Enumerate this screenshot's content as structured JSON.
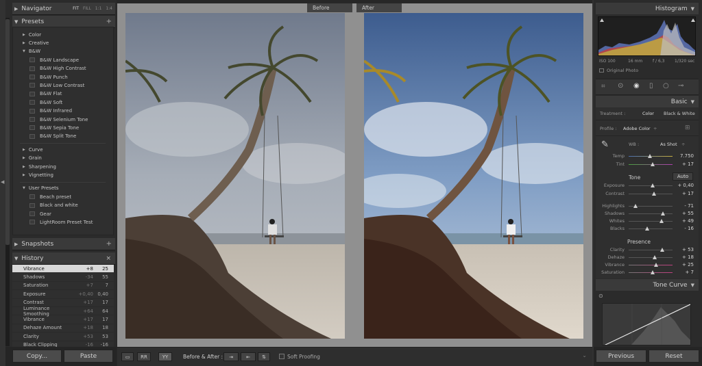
{
  "left_panel": {
    "navigator": {
      "title": "Navigator",
      "zoom_options": [
        "FIT",
        "FILL",
        "1:1",
        "1:4"
      ]
    },
    "presets": {
      "title": "Presets",
      "add_symbol": "+",
      "groups_top": [
        "Color",
        "Creative",
        "B&W"
      ],
      "bw_items": [
        "B&W Landscape",
        "B&W High Contrast",
        "B&W Punch",
        "B&W Low Contrast",
        "B&W Flat",
        "B&W Soft",
        "B&W Infrared",
        "B&W Selenium Tone",
        "B&W Sepia Tone",
        "B&W Split Tone"
      ],
      "groups_mid": [
        "Curve",
        "Grain",
        "Sharpening",
        "Vignetting"
      ],
      "user_group": "User Presets",
      "user_items": [
        "Beach preset",
        "Black and white",
        "Gear",
        "LightRoom Preset Test"
      ]
    },
    "snapshots": {
      "title": "Snapshots",
      "add_symbol": "+"
    },
    "history": {
      "title": "History",
      "close_symbol": "×",
      "rows": [
        {
          "name": "Vibrance",
          "delta": "+8",
          "value": "25",
          "selected": true
        },
        {
          "name": "Shadows",
          "delta": "-34",
          "value": "55"
        },
        {
          "name": "Saturation",
          "delta": "+7",
          "value": "7"
        },
        {
          "name": "Exposure",
          "delta": "+0,40",
          "value": "0,40"
        },
        {
          "name": "Contrast",
          "delta": "+17",
          "value": "17"
        },
        {
          "name": "Luminance Smoothing",
          "delta": "+64",
          "value": "64"
        },
        {
          "name": "Vibrance",
          "delta": "+17",
          "value": "17"
        },
        {
          "name": "Dehaze Amount",
          "delta": "+18",
          "value": "18"
        },
        {
          "name": "Clarity",
          "delta": "+53",
          "value": "53"
        },
        {
          "name": "Black Clipping",
          "delta": "-16",
          "value": "-16"
        }
      ]
    },
    "buttons": {
      "copy": "Copy...",
      "paste": "Paste"
    }
  },
  "center": {
    "before_label": "Before",
    "after_label": "After",
    "toolbar": {
      "view_buttons": [
        "▭",
        "RR",
        "YY"
      ],
      "before_after_label": "Before & After :",
      "soft_proofing": "Soft Proofing"
    }
  },
  "right_panel": {
    "histogram": {
      "title": "Histogram",
      "iso": "ISO 100",
      "focal": "16 mm",
      "aperture": "f / 6,3",
      "shutter": "1/320 sec",
      "original_photo": "Original Photo"
    },
    "basic": {
      "title": "Basic",
      "treatment_label": "Treatment :",
      "treatment_color": "Color",
      "treatment_bw": "Black & White",
      "profile_label": "Profile :",
      "profile_value": "Adobe Color",
      "profile_arrow": "÷",
      "wb_label": "WB :",
      "wb_value": "As Shot",
      "wb_arrow": "÷",
      "tone_label": "Tone",
      "auto_label": "Auto",
      "presence_label": "Presence",
      "sliders": [
        {
          "label": "Temp",
          "value": "7.750",
          "pos": 0.48,
          "group": "wb"
        },
        {
          "label": "Tint",
          "value": "+ 17",
          "pos": 0.55,
          "group": "wb"
        },
        {
          "label": "Exposure",
          "value": "+ 0,40",
          "pos": 0.55,
          "group": "tone"
        },
        {
          "label": "Contrast",
          "value": "+ 17",
          "pos": 0.58,
          "group": "tone"
        },
        {
          "label": "Highlights",
          "value": "- 71",
          "pos": 0.15,
          "group": "tone2"
        },
        {
          "label": "Shadows",
          "value": "+ 55",
          "pos": 0.78,
          "group": "tone2"
        },
        {
          "label": "Whites",
          "value": "+ 49",
          "pos": 0.75,
          "group": "tone2"
        },
        {
          "label": "Blacks",
          "value": "- 16",
          "pos": 0.42,
          "group": "tone2"
        },
        {
          "label": "Clarity",
          "value": "+ 53",
          "pos": 0.77,
          "group": "presence"
        },
        {
          "label": "Dehaze",
          "value": "+ 18",
          "pos": 0.59,
          "group": "presence"
        },
        {
          "label": "Vibrance",
          "value": "+ 25",
          "pos": 0.62,
          "group": "presence"
        },
        {
          "label": "Saturation",
          "value": "+ 7",
          "pos": 0.54,
          "group": "presence"
        }
      ]
    },
    "tone_curve": {
      "title": "Tone Curve"
    },
    "buttons": {
      "previous": "Previous",
      "reset": "Reset"
    }
  }
}
